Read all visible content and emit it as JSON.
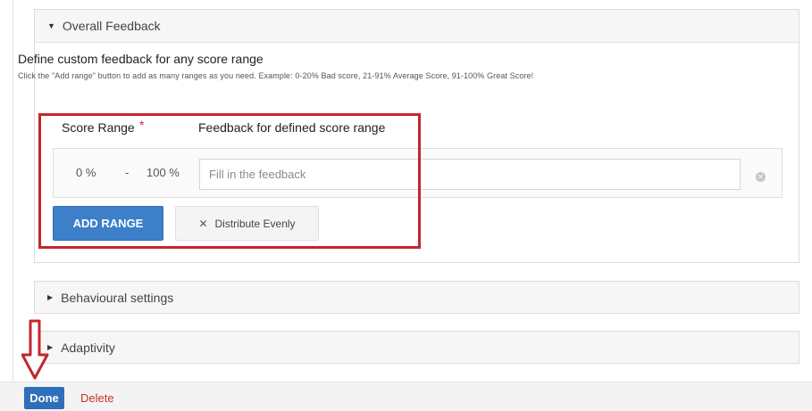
{
  "overall_feedback": {
    "header": "Overall Feedback",
    "title": "Define custom feedback for any score range",
    "hint": "Click the \"Add range\" button to add as many ranges as you need. Example: 0-20% Bad score, 21-91% Average Score, 91-100% Great Score!",
    "col_score_range": "Score Range",
    "required_mark": "*",
    "col_feedback": "Feedback for defined score range",
    "range": {
      "from": "0 %",
      "separator": "-",
      "to": "100 %",
      "placeholder": "Fill in the feedback",
      "value": ""
    },
    "add_range_label": "ADD RANGE",
    "distribute_label": "Distribute Evenly"
  },
  "sections": {
    "behavioural": "Behavioural settings",
    "adaptivity": "Adaptivity"
  },
  "footer": {
    "done_label": "Done",
    "delete_label": "Delete"
  },
  "icons": {
    "expanded": "caret-down-icon",
    "collapsed": "caret-right-icon",
    "remove": "remove-circle-icon",
    "distribute": "close-x-icon"
  },
  "colors": {
    "primary": "#3d7fc9",
    "danger": "#c9302c",
    "annotation": "#c1272d"
  }
}
